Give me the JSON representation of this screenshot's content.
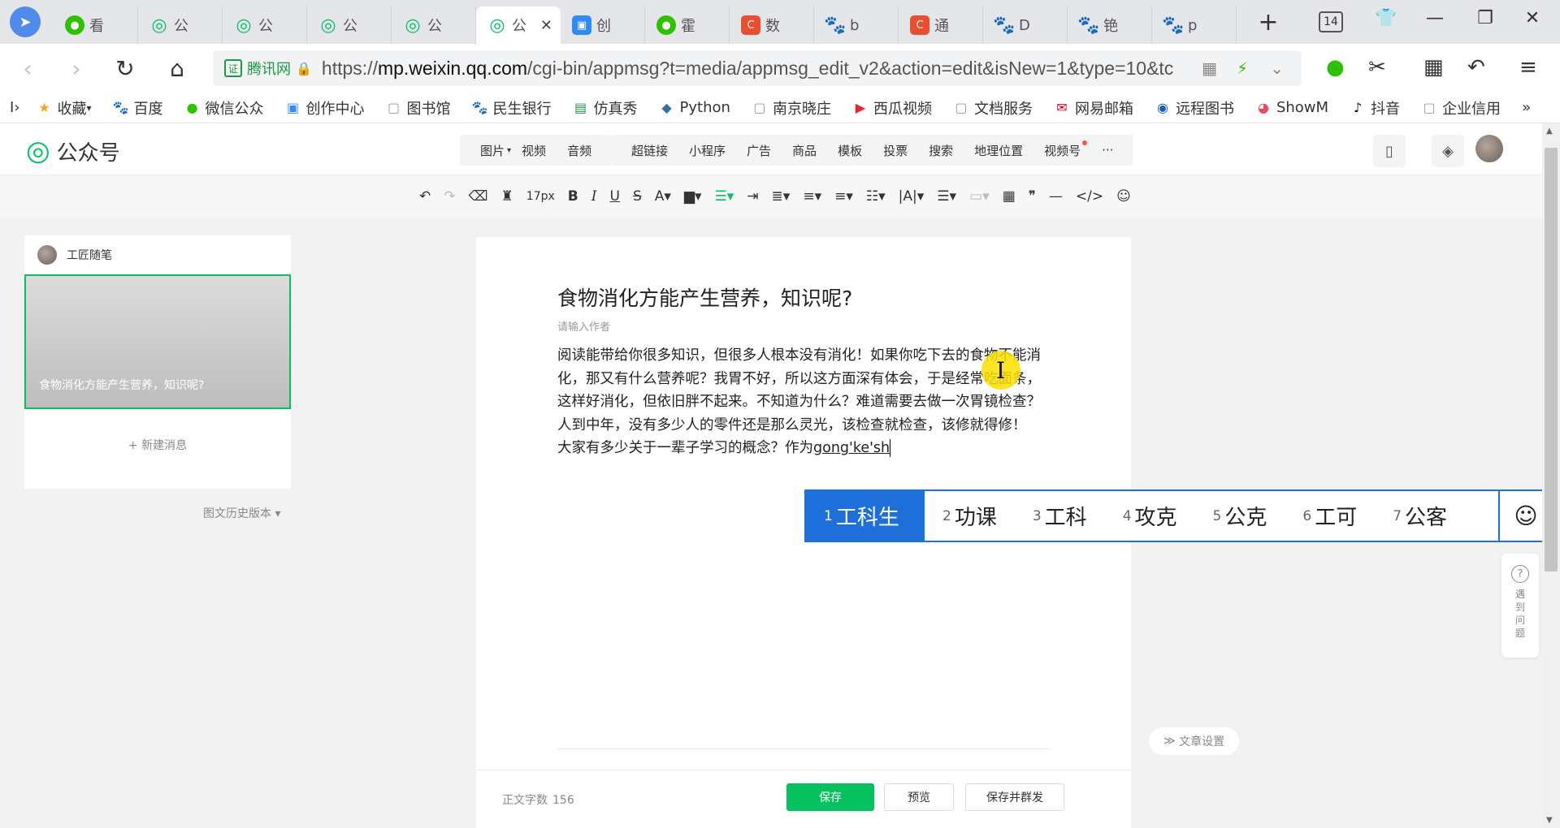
{
  "browser": {
    "tabs": [
      {
        "label": "看",
        "icon": "wechat-icon"
      },
      {
        "label": "公",
        "icon": "gzh-icon"
      },
      {
        "label": "公",
        "icon": "gzh-icon"
      },
      {
        "label": "公",
        "icon": "gzh-icon"
      },
      {
        "label": "公",
        "icon": "gzh-icon"
      },
      {
        "label": "公",
        "icon": "gzh-icon",
        "active": true
      },
      {
        "label": "创",
        "icon": "creator-icon"
      },
      {
        "label": "霍",
        "icon": "wechat-icon"
      },
      {
        "label": "数",
        "icon": "csdn-icon"
      },
      {
        "label": "b",
        "icon": "baidu-icon"
      },
      {
        "label": "通",
        "icon": "csdn-icon"
      },
      {
        "label": "D",
        "icon": "baidu-icon"
      },
      {
        "label": "铯",
        "icon": "baidu-icon"
      },
      {
        "label": "p",
        "icon": "baidu-icon"
      }
    ],
    "tab_count": "14",
    "new_tab": "+",
    "cert_label": "腾讯网",
    "url_prefix": "https://",
    "url_host": "mp.weixin.qq.com",
    "url_path": "/cgi-bin/appmsg?t=media/appmsg_edit_v2&action=edit&isNew=1&type=10&tc",
    "bookmarks": [
      {
        "label": "收藏",
        "icon": "star-icon",
        "color": "#f5a623"
      },
      {
        "label": "百度",
        "icon": "baidu-icon",
        "color": "#2e5cdd"
      },
      {
        "label": "微信公众",
        "icon": "wechat-icon",
        "color": "#2dc100"
      },
      {
        "label": "创作中心",
        "icon": "creator-icon",
        "color": "#2f8cf7"
      },
      {
        "label": "图书馆",
        "icon": "page-icon",
        "color": "#999999"
      },
      {
        "label": "民生银行",
        "icon": "baidu-icon",
        "color": "#2e5cdd"
      },
      {
        "label": "仿真秀",
        "icon": "fzx-icon",
        "color": "#1a9a42"
      },
      {
        "label": "Python",
        "icon": "python-icon",
        "color": "#3670a0"
      },
      {
        "label": "南京晓庄",
        "icon": "page-icon",
        "color": "#999999"
      },
      {
        "label": "西瓜视频",
        "icon": "xigua-icon",
        "color": "#e8262e"
      },
      {
        "label": "文档服务",
        "icon": "page-icon",
        "color": "#999999"
      },
      {
        "label": "网易邮箱",
        "icon": "netease-icon",
        "color": "#d0021b"
      },
      {
        "label": "远程图书",
        "icon": "remote-icon",
        "color": "#1a5fb4"
      },
      {
        "label": "ShowM",
        "icon": "showm-icon",
        "color": "#e84a5f"
      },
      {
        "label": "抖音",
        "icon": "douyin-icon",
        "color": "#111111"
      },
      {
        "label": "企业信用",
        "icon": "page-icon",
        "color": "#999999"
      }
    ]
  },
  "app": {
    "logo": "公众号",
    "insert_group1": [
      "图片",
      "视频",
      "音频"
    ],
    "insert_group2": [
      "超链接",
      "小程序",
      "广告",
      "商品",
      "模板",
      "投票",
      "搜索",
      "地理位置",
      "视频号"
    ],
    "more": "···",
    "font_size": "17px"
  },
  "left": {
    "account": "工匠随笔",
    "article_thumb_title": "食物消化方能产生营养，知识呢?",
    "new_message": "+ 新建消息",
    "history": "图文历史版本"
  },
  "editor": {
    "title": "食物消化方能产生营养，知识呢?",
    "author_placeholder": "请输入作者",
    "paragraph1": "阅读能带给你很多知识，但很多人根本没有消化！如果你吃下去的食物不能消化，那又有什么营养呢？我胃不好，所以这方面深有体会，于是经常吃面条，这样好消化，但依旧胖不起来。不知道为什么？难道需要去做一次胃镜检查？人到中年，没有多少人的零件还是那么灵光，该检查就检查，该修就得修！",
    "paragraph2_text": "大家有多少关于一辈子学习的概念？作为",
    "paragraph2_composing": "gong'ke'sh",
    "word_count_label": "正文字数",
    "word_count": "156",
    "save": "保存",
    "preview": "预览",
    "save_publish": "保存并群发"
  },
  "ime": {
    "candidates": [
      {
        "n": "1",
        "text": "工科生"
      },
      {
        "n": "2",
        "text": "功课"
      },
      {
        "n": "3",
        "text": "工科"
      },
      {
        "n": "4",
        "text": "攻克"
      },
      {
        "n": "5",
        "text": "公克"
      },
      {
        "n": "6",
        "text": "工可"
      },
      {
        "n": "7",
        "text": "公客"
      }
    ],
    "selected": 0
  },
  "side": {
    "help": "遇到问题",
    "article_settings": "文章设置"
  },
  "colors": {
    "brand_green": "#07c160",
    "ime_blue": "#1e6fd9"
  }
}
